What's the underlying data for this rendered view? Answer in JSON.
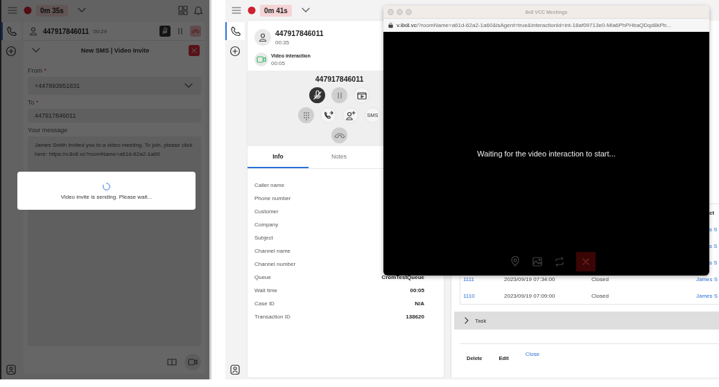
{
  "left_panel": {
    "timer": "0m 35s",
    "call": {
      "number": "447917846011",
      "duration": "00:29"
    },
    "form": {
      "title": "New SMS | Video Invite",
      "fields": [
        {
          "kind": "select",
          "label": "From",
          "mark": "*",
          "value": "+447893951831"
        },
        {
          "kind": "text",
          "label": "To",
          "mark": "*",
          "value": "447917846011"
        },
        {
          "kind": "textarea",
          "label": "Your message",
          "value": "James Smith invited you to a video meeting. To join, please click here: https://v.8x8.vc?roomName=a61d-62a2-1a60"
        }
      ]
    },
    "dialog": {
      "message": "Video invite is sending. Please wait..."
    }
  },
  "right_panel": {
    "timer": "0m 41s",
    "contact": {
      "number": "447917846011",
      "duration": "00:35"
    },
    "interaction": {
      "label": "Video interaction",
      "duration": "00:05"
    },
    "controls": {
      "number": "447917846011",
      "sms_label": "SMS"
    },
    "tabs": [
      {
        "label": "Info",
        "selected": true
      },
      {
        "label": "Notes",
        "selected": false
      }
    ],
    "info": [
      {
        "label": "Caller name"
      },
      {
        "label": "Phone number"
      },
      {
        "label": "Customer"
      },
      {
        "label": "Company"
      },
      {
        "label": "Subject"
      },
      {
        "label": "Channel name"
      },
      {
        "label": "Channel number"
      },
      {
        "label": "Queue",
        "value": "CromTestQueue"
      },
      {
        "label": "Wait time",
        "value": "00:05"
      },
      {
        "label": "Case ID",
        "value": "N/A"
      },
      {
        "label": "Transaction ID",
        "value": "138620"
      }
    ],
    "table": {
      "header_fragment": "ct",
      "rows": [
        {
          "name": "s S"
        },
        {
          "name": "s S"
        },
        {
          "name": "s S"
        },
        {
          "id": "1111",
          "date": "2023/09/19 07:34:00",
          "status": "Closed",
          "name": "James S"
        },
        {
          "id": "1110",
          "date": "2023/09/19 07:09:00",
          "status": "Closed",
          "name": "James S"
        }
      ]
    },
    "task": {
      "label": "Task",
      "expanded": false
    },
    "actions": [
      {
        "label": "Delete",
        "kind": "button"
      },
      {
        "label": "Edit",
        "kind": "button"
      },
      {
        "label": "Close",
        "kind": "link"
      }
    ]
  },
  "video_window": {
    "title": "8x8 VCC Meetings",
    "url": "**v.8x8.vc**/?roomName=a61d-62a2-1a60&isAgent=true&interactionId=int-18af09713e0-Mla6PhPHbaQDqd8kPb...",
    "message": "Waiting for the video interaction to start..."
  }
}
